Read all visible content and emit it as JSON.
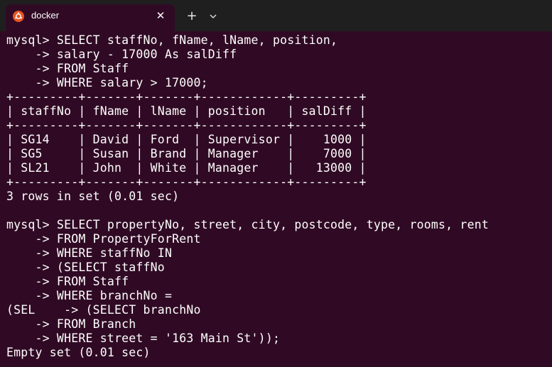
{
  "window": {
    "tab_title": "docker",
    "tab_icon": "ubuntu-logo-icon",
    "close_symbol": "✕",
    "new_tab_symbol": "+",
    "dropdown_icon": "chevron-down-icon"
  },
  "colors": {
    "terminal_background": "#300a24",
    "titlebar_background": "#1f1f1f",
    "text": "#ffffff",
    "ubuntu_orange": "#e95420"
  },
  "terminal": {
    "lines": [
      "mysql> SELECT staffNo, fName, lName, position,",
      "    -> salary - 17000 As salDiff",
      "    -> FROM Staff",
      "    -> WHERE salary > 17000;",
      "+---------+-------+-------+------------+---------+",
      "| staffNo | fName | lName | position   | salDiff |",
      "+---------+-------+-------+------------+---------+",
      "| SG14    | David | Ford  | Supervisor |    1000 |",
      "| SG5     | Susan | Brand | Manager    |    7000 |",
      "| SL21    | John  | White | Manager    |   13000 |",
      "+---------+-------+-------+------------+---------+",
      "3 rows in set (0.01 sec)",
      "",
      "mysql> SELECT propertyNo, street, city, postcode, type, rooms, rent",
      "    -> FROM PropertyForRent",
      "    -> WHERE staffNo IN",
      "    -> (SELECT staffNo",
      "    -> FROM Staff",
      "    -> WHERE branchNo =",
      "(SEL    -> (SELECT branchNo",
      "    -> FROM Branch",
      "    -> WHERE street = '163 Main St'));",
      "Empty set (0.01 sec)"
    ]
  }
}
